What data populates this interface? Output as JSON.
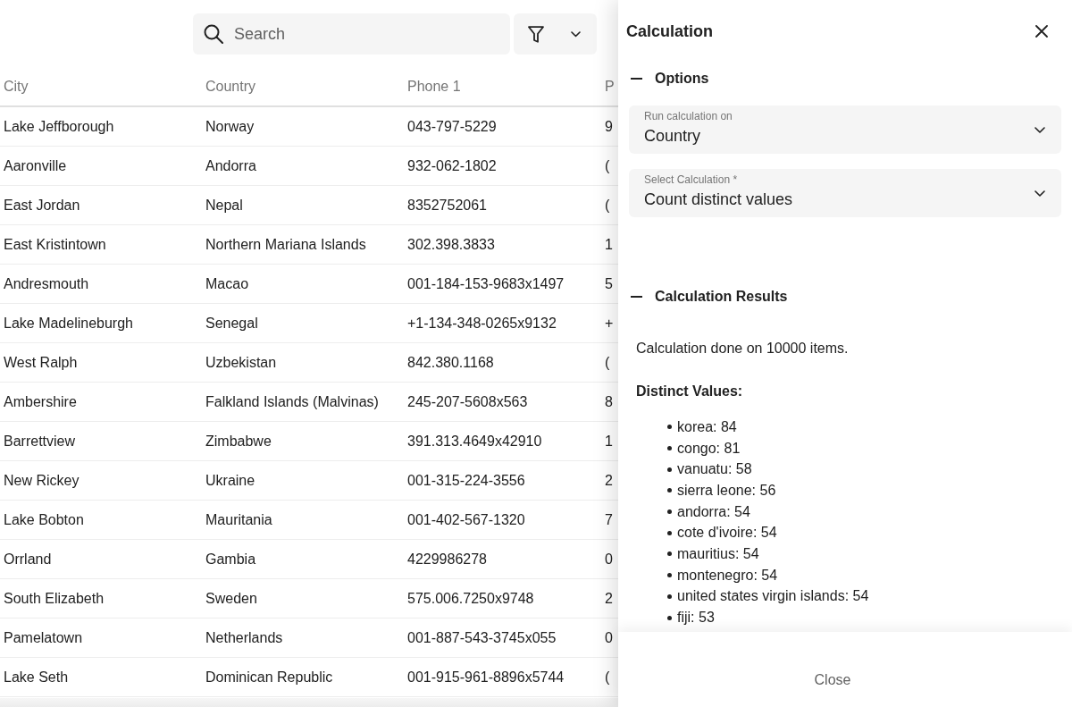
{
  "toolbar": {
    "search": {
      "placeholder": "Search"
    }
  },
  "table": {
    "columns": [
      "City",
      "Country",
      "Phone 1",
      "P"
    ],
    "rows": [
      [
        "Lake Jeffborough",
        "Norway",
        "043-797-5229",
        "9"
      ],
      [
        "Aaronville",
        "Andorra",
        "932-062-1802",
        "("
      ],
      [
        "East Jordan",
        "Nepal",
        "8352752061",
        "("
      ],
      [
        "East Kristintown",
        "Northern Mariana Islands",
        "302.398.3833",
        "1"
      ],
      [
        "Andresmouth",
        "Macao",
        "001-184-153-9683x1497",
        "5"
      ],
      [
        "Lake Madelineburgh",
        "Senegal",
        "+1-134-348-0265x9132",
        "+"
      ],
      [
        "West Ralph",
        "Uzbekistan",
        "842.380.1168",
        "("
      ],
      [
        "Ambershire",
        "Falkland Islands (Malvinas)",
        "245-207-5608x563",
        "8"
      ],
      [
        "Barrettview",
        "Zimbabwe",
        "391.313.4649x42910",
        "1"
      ],
      [
        "New Rickey",
        "Ukraine",
        "001-315-224-3556",
        "2"
      ],
      [
        "Lake Bobton",
        "Mauritania",
        "001-402-567-1320",
        "7"
      ],
      [
        "Orrland",
        "Gambia",
        "4229986278",
        "0"
      ],
      [
        "South Elizabeth",
        "Sweden",
        "575.006.7250x9748",
        "2"
      ],
      [
        "Pamelatown",
        "Netherlands",
        "001-887-543-3745x055",
        "0"
      ],
      [
        "Lake Seth",
        "Dominican Republic",
        "001-915-961-8896x5744",
        "("
      ]
    ]
  },
  "drawer": {
    "title": "Calculation",
    "sections": [
      {
        "kind": "options",
        "title": "Options",
        "expanded": true,
        "fields": [
          {
            "label": "Run calculation on",
            "value": "Country"
          },
          {
            "label": "Select Calculation *",
            "value": "Count distinct values"
          }
        ]
      },
      {
        "kind": "results",
        "title": "Calculation Results",
        "expanded": true,
        "summary": "Calculation done on 10000 items.",
        "heading": "Distinct Values:",
        "items": [
          "korea: 84",
          "congo: 81",
          "vanuatu: 58",
          "sierra leone: 56",
          "andorra: 54",
          "cote d'ivoire: 54",
          "mauritius: 54",
          "montenegro: 54",
          "united states virgin islands: 54",
          "fiji: 53"
        ]
      }
    ],
    "footer_button": "Close"
  }
}
